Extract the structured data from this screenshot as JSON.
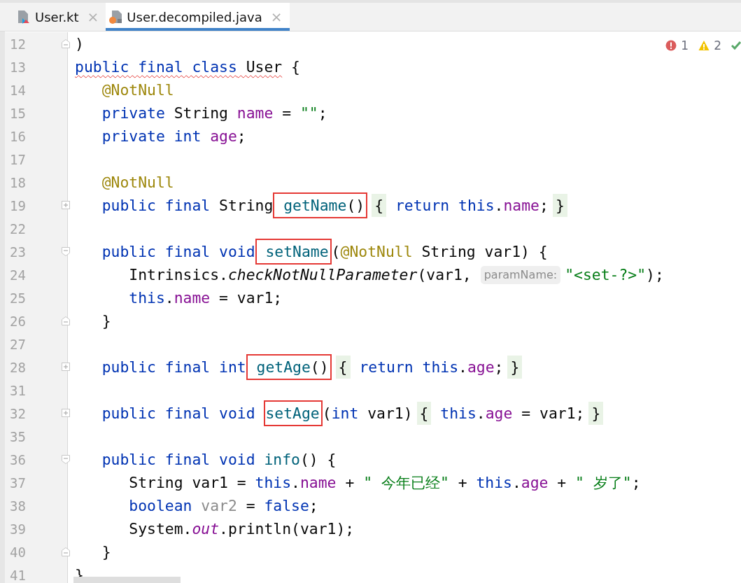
{
  "tabs": [
    {
      "label": "User.kt",
      "kind": "kotlin",
      "close": "×",
      "selected": false
    },
    {
      "label": "User.decompiled.java",
      "kind": "java",
      "close": "×",
      "selected": true
    }
  ],
  "problems": [
    {
      "kind": "error",
      "count": "1"
    },
    {
      "kind": "warning",
      "count": "2"
    },
    {
      "kind": "ok"
    }
  ],
  "lines": [
    {
      "number": "12",
      "kind": "fold-end",
      "tokens": [
        {
          "text": ")",
          "kind": "plain"
        }
      ]
    },
    {
      "number": "13",
      "kind": "plain",
      "tokens": [
        {
          "text": "public final class",
          "kind": "kw",
          "squiggle": true
        },
        {
          "text": " User",
          "kind": "plain",
          "squiggle": true
        },
        {
          "text": " {",
          "kind": "plain"
        }
      ]
    },
    {
      "number": "14",
      "kind": "plain",
      "tokens": [
        {
          "text": "   @NotNull",
          "kind": "annot"
        }
      ]
    },
    {
      "number": "15",
      "kind": "plain",
      "tokens": [
        {
          "text": "   private",
          "kind": "kw"
        },
        {
          "text": " String ",
          "kind": "plain"
        },
        {
          "text": "name",
          "kind": "field"
        },
        {
          "text": " = ",
          "kind": "plain"
        },
        {
          "text": "\"\"",
          "kind": "string"
        },
        {
          "text": ";",
          "kind": "plain"
        }
      ]
    },
    {
      "number": "16",
      "kind": "plain",
      "tokens": [
        {
          "text": "   private int",
          "kind": "kw"
        },
        {
          "text": " age",
          "kind": "field"
        },
        {
          "text": ";",
          "kind": "plain"
        }
      ]
    },
    {
      "number": "17",
      "kind": "plain"
    },
    {
      "number": "18",
      "kind": "plain",
      "tokens": [
        {
          "text": "   @NotNull",
          "kind": "annot"
        }
      ]
    },
    {
      "number": "19",
      "kind": "collapsed",
      "tokens": [
        {
          "text": "   public final",
          "kind": "kw"
        },
        {
          "text": " String",
          "kind": "plain"
        },
        {
          "kind": "box",
          "tokens": [
            {
              "text": " getName",
              "kind": "method"
            },
            {
              "text": "()",
              "kind": "plain"
            }
          ]
        },
        {
          "text": "{",
          "kind": "folded"
        },
        {
          "text": " return this",
          "kind": "kw"
        },
        {
          "text": ".",
          "kind": "plain"
        },
        {
          "text": "name",
          "kind": "field"
        },
        {
          "text": ";",
          "kind": "plain"
        },
        {
          "text": "}",
          "kind": "folded"
        }
      ]
    },
    {
      "number": "22",
      "kind": "plain"
    },
    {
      "number": "23",
      "kind": "fold-start",
      "tokens": [
        {
          "text": "   public final void",
          "kind": "kw"
        },
        {
          "kind": "box",
          "tokens": [
            {
              "text": " setName",
              "kind": "method"
            }
          ]
        },
        {
          "text": "(",
          "kind": "plain"
        },
        {
          "text": "@NotNull",
          "kind": "annot"
        },
        {
          "text": " String var1) {",
          "kind": "plain"
        }
      ]
    },
    {
      "number": "24",
      "kind": "plain",
      "tokens": [
        {
          "text": "      Intrinsics.",
          "kind": "plain"
        },
        {
          "text": "checkNotNullParameter",
          "kind": "italic"
        },
        {
          "text": "(var1,",
          "kind": "plain"
        },
        {
          "text": "paramName:",
          "kind": "hint"
        },
        {
          "text": "\"<set-?>\"",
          "kind": "string"
        },
        {
          "text": ");",
          "kind": "plain"
        }
      ]
    },
    {
      "number": "25",
      "kind": "plain",
      "tokens": [
        {
          "text": "      this",
          "kind": "kw"
        },
        {
          "text": ".",
          "kind": "plain"
        },
        {
          "text": "name",
          "kind": "field"
        },
        {
          "text": " = var1;",
          "kind": "plain"
        }
      ]
    },
    {
      "number": "26",
      "kind": "fold-end",
      "tokens": [
        {
          "text": "   }",
          "kind": "plain"
        }
      ]
    },
    {
      "number": "27",
      "kind": "plain"
    },
    {
      "number": "28",
      "kind": "collapsed",
      "tokens": [
        {
          "text": "   public final int",
          "kind": "kw"
        },
        {
          "kind": "box",
          "tokens": [
            {
              "text": " getAge",
              "kind": "method"
            },
            {
              "text": "()",
              "kind": "plain"
            }
          ]
        },
        {
          "text": "{",
          "kind": "folded"
        },
        {
          "text": " return this",
          "kind": "kw"
        },
        {
          "text": ".",
          "kind": "plain"
        },
        {
          "text": "age",
          "kind": "field"
        },
        {
          "text": ";",
          "kind": "plain"
        },
        {
          "text": "}",
          "kind": "folded"
        }
      ]
    },
    {
      "number": "31",
      "kind": "plain"
    },
    {
      "number": "32",
      "kind": "collapsed",
      "tokens": [
        {
          "text": "   public final void ",
          "kind": "kw"
        },
        {
          "kind": "box",
          "tokens": [
            {
              "text": "setAge",
              "kind": "method"
            }
          ]
        },
        {
          "text": "(",
          "kind": "plain"
        },
        {
          "text": "int",
          "kind": "kw"
        },
        {
          "text": " var1)",
          "kind": "plain"
        },
        {
          "text": "{",
          "kind": "folded"
        },
        {
          "text": " this",
          "kind": "kw"
        },
        {
          "text": ".",
          "kind": "plain"
        },
        {
          "text": "age",
          "kind": "field"
        },
        {
          "text": " = var1;",
          "kind": "plain"
        },
        {
          "text": "}",
          "kind": "folded"
        }
      ]
    },
    {
      "number": "35",
      "kind": "plain"
    },
    {
      "number": "36",
      "kind": "fold-start",
      "tokens": [
        {
          "text": "   public final void ",
          "kind": "kw"
        },
        {
          "text": "info",
          "kind": "method"
        },
        {
          "text": "() {",
          "kind": "plain"
        }
      ]
    },
    {
      "number": "37",
      "kind": "plain",
      "tokens": [
        {
          "text": "      String var1 = ",
          "kind": "plain"
        },
        {
          "text": "this",
          "kind": "kw"
        },
        {
          "text": ".",
          "kind": "plain"
        },
        {
          "text": "name",
          "kind": "field"
        },
        {
          "text": " + ",
          "kind": "plain"
        },
        {
          "text": "\" 今年已经\"",
          "kind": "string"
        },
        {
          "text": " + ",
          "kind": "plain"
        },
        {
          "text": "this",
          "kind": "kw"
        },
        {
          "text": ".",
          "kind": "plain"
        },
        {
          "text": "age",
          "kind": "field"
        },
        {
          "text": " + ",
          "kind": "plain"
        },
        {
          "text": "\" 岁了\"",
          "kind": "string"
        },
        {
          "text": ";",
          "kind": "plain"
        }
      ]
    },
    {
      "number": "38",
      "kind": "plain",
      "tokens": [
        {
          "text": "      boolean ",
          "kind": "kw"
        },
        {
          "text": "var2",
          "kind": "unused"
        },
        {
          "text": " = ",
          "kind": "plain"
        },
        {
          "text": "false",
          "kind": "kw"
        },
        {
          "text": ";",
          "kind": "plain"
        }
      ]
    },
    {
      "number": "39",
      "kind": "plain",
      "tokens": [
        {
          "text": "      System.",
          "kind": "plain"
        },
        {
          "text": "out",
          "kind": "static"
        },
        {
          "text": ".println(var1);",
          "kind": "plain"
        }
      ]
    },
    {
      "number": "40",
      "kind": "fold-end",
      "tokens": [
        {
          "text": "   }",
          "kind": "plain"
        }
      ]
    },
    {
      "number": "41",
      "kind": "plain",
      "tokens": [
        {
          "text": "}",
          "kind": "plain"
        }
      ]
    }
  ]
}
